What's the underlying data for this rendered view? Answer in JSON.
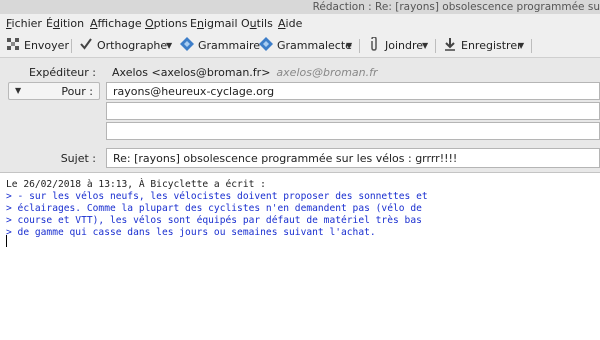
{
  "window": {
    "title": "Rédaction : Re: [rayons] obsolescence programmée su"
  },
  "menu": [
    "Fichier",
    "Édition",
    "Affichage",
    "Options",
    "Enigmail",
    "Outils",
    "Aide"
  ],
  "menu_mnemonic": [
    "F",
    "d",
    "A",
    "O",
    "n",
    "u",
    "A"
  ],
  "toolbar": {
    "send": "Envoyer",
    "spelling": "Orthographe",
    "grammar": "Grammaire",
    "grammalecte": "Grammalecte",
    "attach": "Joindre",
    "save": "Enregistrer"
  },
  "icons": {
    "send": "send-icon",
    "spelling": "checkmark-icon",
    "grammar": "grammar-diamond-icon",
    "grammalecte": "grammalecte-diamond-icon",
    "attach": "paperclip-icon",
    "save": "download-arrow-icon"
  },
  "colors": {
    "quote_text": "#1a2fd0",
    "grammar_icon": "#3d7ec9"
  },
  "header": {
    "from_label": "Expéditeur :",
    "from_value": "Axelos <axelos@broman.fr>",
    "from_alias": "axelos@broman.fr",
    "recipient_type": "Pour :",
    "to_value": "rayons@heureux-cyclage.org",
    "subject_label": "Sujet :",
    "subject_value": "Re: [rayons] obsolescence programmée sur les vélos : grrrr!!!!"
  },
  "body": {
    "attribution": "Le 26/02/2018 à 13:13, À Bicyclette a écrit :",
    "quoted_lines": [
      "> - sur les vélos neufs, les vélocistes doivent proposer des sonnettes et",
      "> éclairages. Comme la plupart des cyclistes n'en demandent pas (vélo de",
      "> course et VTT), les vélos sont équipés par défaut de matériel très bas",
      "> de gamme qui casse dans les jours ou semaines suivant l'achat."
    ]
  }
}
